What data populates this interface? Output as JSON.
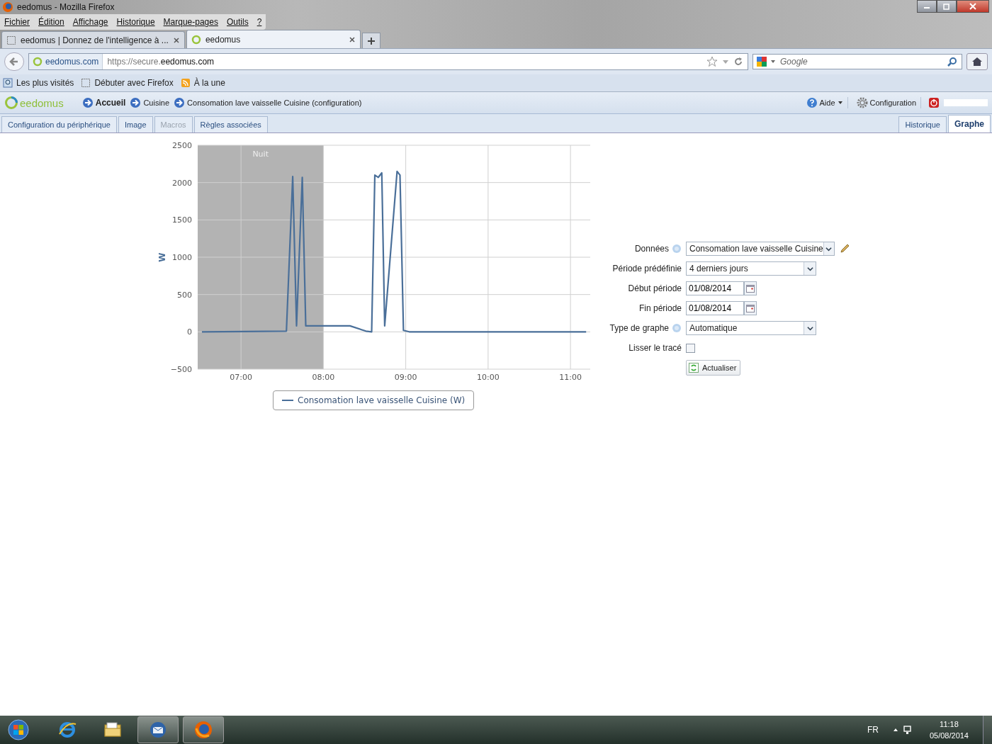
{
  "window": {
    "title": "eedomus - Mozilla Firefox"
  },
  "menu": [
    "Fichier",
    "Édition",
    "Affichage",
    "Historique",
    "Marque-pages",
    "Outils",
    "?"
  ],
  "browser_tabs": [
    {
      "label": "eedomus | Donnez de l'intelligence à ...",
      "selected": false,
      "kind": "blank"
    },
    {
      "label": "eedomus",
      "selected": true,
      "kind": "site"
    }
  ],
  "address_bar": {
    "site": "eedomus.com",
    "url_prefix": "https://secure.",
    "url_domain": "eedomus.com"
  },
  "search": {
    "placeholder": "Google"
  },
  "bookmarks": [
    {
      "label": "Les plus visités",
      "kind": "search"
    },
    {
      "label": "Débuter avec Firefox",
      "kind": "blank"
    },
    {
      "label": "À la une",
      "kind": "feed"
    }
  ],
  "app": {
    "logo": "eedomus",
    "breadcrumbs": [
      {
        "label": "Accueil",
        "kind": "home"
      },
      {
        "label": "Cuisine",
        "kind": "page"
      },
      {
        "label": "Consomation lave vaisselle Cuisine (configuration)",
        "kind": "page"
      }
    ],
    "actions": [
      {
        "label": "Aide",
        "kind": "help"
      },
      {
        "label": "Configuration",
        "kind": "settings"
      }
    ]
  },
  "page_tabs_left": [
    {
      "label": "Configuration du périphérique",
      "selected": false,
      "disabled": false
    },
    {
      "label": "Image",
      "selected": false,
      "disabled": false
    },
    {
      "label": "Macros",
      "selected": false,
      "disabled": true
    },
    {
      "label": "Règles associées",
      "selected": false,
      "disabled": false
    }
  ],
  "page_tabs_right": [
    {
      "label": "Historique",
      "selected": false
    },
    {
      "label": "Graphe",
      "selected": true
    }
  ],
  "chart_data": {
    "type": "line",
    "ylabel": "W",
    "xlim": [
      6.474,
      11.24
    ],
    "ylim": [
      -500,
      2500
    ],
    "xticks": [
      {
        "value": 7,
        "label": "07:00"
      },
      {
        "value": 8,
        "label": "08:00"
      },
      {
        "value": 9,
        "label": "09:00"
      },
      {
        "value": 10,
        "label": "10:00"
      },
      {
        "value": 11,
        "label": "11:00"
      }
    ],
    "yticks": [
      {
        "value": -500,
        "label": "−500"
      },
      {
        "value": 0,
        "label": "0"
      },
      {
        "value": 500,
        "label": "500"
      },
      {
        "value": 1000,
        "label": "1000"
      },
      {
        "value": 1500,
        "label": "1500"
      },
      {
        "value": 2000,
        "label": "2000"
      },
      {
        "value": 2500,
        "label": "2500"
      }
    ],
    "x": [
      6.526,
      7.551,
      7.628,
      7.674,
      7.744,
      7.786,
      8.323,
      8.516,
      8.586,
      8.625,
      8.667,
      8.709,
      8.744,
      8.895,
      8.93,
      8.972,
      9.042,
      11.19
    ],
    "series": [
      {
        "name": "Consomation lave vaisselle Cuisine (W)",
        "color": "#4a6f99",
        "values": [
          0,
          10,
          2080,
          80,
          2070,
          80,
          80,
          10,
          0,
          2100,
          2070,
          2130,
          80,
          2150,
          2100,
          20,
          0,
          0
        ]
      }
    ],
    "grid": true,
    "bands": [
      {
        "axis": "x",
        "from": 6.474,
        "to": 8,
        "label": "Nuit"
      }
    ]
  },
  "form": [
    {
      "label": "Données",
      "help": true,
      "kind": "select",
      "value": "Consomation lave vaisselle Cuisine",
      "editable": true
    },
    {
      "label": "Période prédéfinie",
      "help": false,
      "kind": "select",
      "value": "4 derniers jours",
      "editable": false
    },
    {
      "label": "Début période",
      "help": false,
      "kind": "date",
      "value": "01/08/2014"
    },
    {
      "label": "Fin période",
      "help": false,
      "kind": "date",
      "value": "01/08/2014"
    },
    {
      "label": "Type de graphe",
      "help": true,
      "kind": "select",
      "value": "Automatique",
      "editable": false
    },
    {
      "label": "Lisser le tracé",
      "help": false,
      "kind": "checkbox",
      "checked": false
    }
  ],
  "refresh_button": "Actualiser",
  "taskbar": {
    "apps": [
      {
        "kind": "ie",
        "selected": false
      },
      {
        "kind": "folder",
        "selected": false
      },
      {
        "kind": "mail",
        "selected": true
      },
      {
        "kind": "firefox",
        "selected": true
      }
    ],
    "language": "FR",
    "time": "11:18",
    "date": "05/08/2014"
  }
}
